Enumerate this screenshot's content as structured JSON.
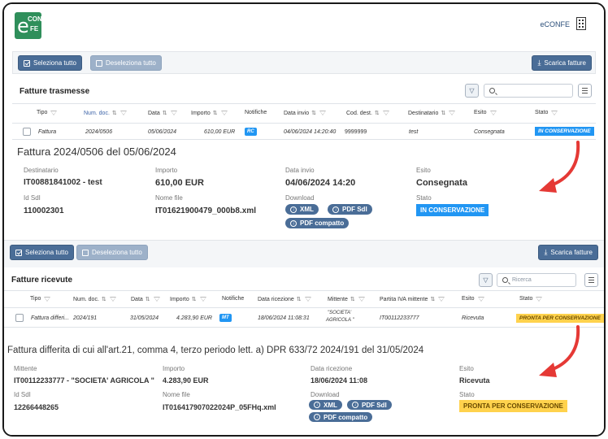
{
  "app": {
    "brand": "eCONFE",
    "logo_text_e": "e",
    "logo_text_con": "CON",
    "logo_text_fe": "FE"
  },
  "colors": {
    "primary": "#4a6d97",
    "muted_button": "#9db1c9",
    "status_blue": "#2196f3",
    "status_yellow": "#ffd24d",
    "logo_green": "#2f8f5b",
    "arrow_red": "#e53935"
  },
  "sent": {
    "toolbar": {
      "select_all": "Seleziona tutto",
      "deselect_all": "Deseleziona tutto",
      "download": "Scarica fatture"
    },
    "title": "Fatture trasmesse",
    "search_placeholder": "",
    "columns": [
      "Tipo",
      "Num. doc.",
      "Data",
      "Importo",
      "Notifiche",
      "Data invio",
      "Cod. dest.",
      "Destinatario",
      "Esito",
      "Stato"
    ],
    "row": {
      "tipo": "Fattura",
      "num_doc": "2024/0506",
      "data": "05/06/2024",
      "importo": "610,00 EUR",
      "notifica": "RC",
      "data_invio": "04/06/2024 14:20:40",
      "cod_dest": "9999999",
      "destinatario": "test",
      "esito": "Consegnata",
      "stato": "IN CONSERVAZIONE"
    },
    "detail": {
      "title": "Fattura 2024/0506 del 05/06/2024",
      "destinatario_label": "Destinatario",
      "destinatario": "IT00881841002 - test",
      "importo_label": "Importo",
      "importo": "610,00 EUR",
      "data_invio_label": "Data invio",
      "data_invio": "04/06/2024 14:20",
      "esito_label": "Esito",
      "esito": "Consegnata",
      "idsdi_label": "Id SdI",
      "idsdi": "110002301",
      "nomefile_label": "Nome file",
      "nomefile": "IT01621900479_000b8.xml",
      "download_label": "Download",
      "xml": "XML",
      "pdf_sdi": "PDF SdI",
      "pdf_compatto": "PDF compatto",
      "stato_label": "Stato",
      "stato": "IN CONSERVAZIONE"
    }
  },
  "received": {
    "toolbar": {
      "select_all": "Seleziona tutto",
      "deselect_all": "Deseleziona tutto",
      "download": "Scarica fatture"
    },
    "title": "Fatture ricevute",
    "search_placeholder": "Ricerca",
    "columns": [
      "Tipo",
      "Num. doc.",
      "Data",
      "Importo",
      "Notifiche",
      "Data ricezione",
      "Mittente",
      "Partita IVA mittente",
      "Esito",
      "Stato"
    ],
    "row": {
      "tipo": "Fattura differi...",
      "num_doc": "2024/191",
      "data": "31/05/2024",
      "importo": "4.283,90 EUR",
      "notifica": "MT",
      "data_ricezione": "18/06/2024 11:08:31",
      "mittente_1": "\"SOCIETA'",
      "mittente_2": "AGRICOLA \"",
      "piva": "IT00112233777",
      "esito": "Ricevuta",
      "stato": "PRONTA PER CONSERVAZIONE"
    },
    "detail": {
      "title": "Fattura differita di cui all'art.21, comma 4, terzo periodo lett. a) DPR 633/72 2024/191 del 31/05/2024",
      "mittente_label": "Mittente",
      "mittente": "IT00112233777 - \"SOCIETA' AGRICOLA \"",
      "importo_label": "Importo",
      "importo": "4.283,90 EUR",
      "data_ricezione_label": "Data ricezione",
      "data_ricezione": "18/06/2024 11:08",
      "esito_label": "Esito",
      "esito": "Ricevuta",
      "idsdi_label": "Id SdI",
      "idsdi": "12266448265",
      "nomefile_label": "Nome file",
      "nomefile": "IT01641790702​2024P_05FHq.xml",
      "download_label": "Download",
      "xml": "XML",
      "pdf_sdi": "PDF SdI",
      "pdf_compatto": "PDF compatto",
      "stato_label": "Stato",
      "stato": "PRONTA PER CONSERVAZIONE"
    }
  }
}
